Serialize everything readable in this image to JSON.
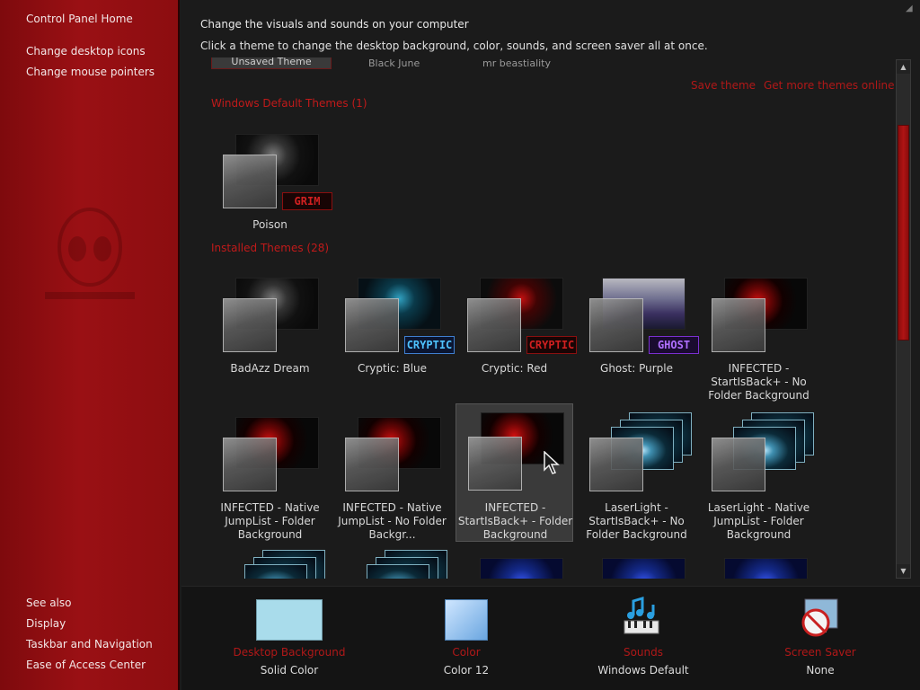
{
  "sidebar": {
    "home": "Control Panel Home",
    "links": [
      "Change desktop icons",
      "Change mouse pointers"
    ],
    "see_also_title": "See also",
    "see_also": [
      "Display",
      "Taskbar and Navigation",
      "Ease of Access Center"
    ]
  },
  "header": {
    "title": "Change the visuals and sounds on your computer",
    "subtitle": "Click a theme to change the desktop background, color, sounds, and screen saver all at once."
  },
  "my_themes_cut": [
    "Unsaved Theme",
    "Black June",
    "mr beastiality"
  ],
  "actions": {
    "save": "Save theme",
    "get_more": "Get more themes online"
  },
  "groups": {
    "windows_default": "Windows Default Themes (1)",
    "installed": "Installed Themes (28)"
  },
  "default_themes": [
    {
      "name": "Poison",
      "badge": "GRIM"
    }
  ],
  "installed_themes": [
    {
      "name": "BadAzz Dream",
      "badge": ""
    },
    {
      "name": "Cryptic: Blue",
      "badge": "CRYPTIC"
    },
    {
      "name": "Cryptic: Red",
      "badge": "CRYPTIC"
    },
    {
      "name": "Ghost: Purple",
      "badge": "GHOST"
    },
    {
      "name": "INFECTED - StartIsBack+ - No Folder Background",
      "badge": ""
    },
    {
      "name": "INFECTED - Native JumpList - Folder Background",
      "badge": ""
    },
    {
      "name": "INFECTED - Native JumpList - No Folder Backgr...",
      "badge": ""
    },
    {
      "name": "INFECTED - StartIsBack+ - Folder Background",
      "badge": ""
    },
    {
      "name": "LaserLight - StartIsBack+ - No Folder Background",
      "badge": ""
    },
    {
      "name": "LaserLight - Native JumpList - Folder Background",
      "badge": ""
    }
  ],
  "bottom": {
    "desktop_background": {
      "title": "Desktop Background",
      "value": "Solid Color"
    },
    "color": {
      "title": "Color",
      "value": "Color 12"
    },
    "sounds": {
      "title": "Sounds",
      "value": "Windows Default"
    },
    "screen_saver": {
      "title": "Screen Saver",
      "value": "None"
    }
  },
  "colors": {
    "accent_red": "#b01818",
    "sidebar_red": "#9a1014",
    "solid_color": "#a9dceb"
  }
}
